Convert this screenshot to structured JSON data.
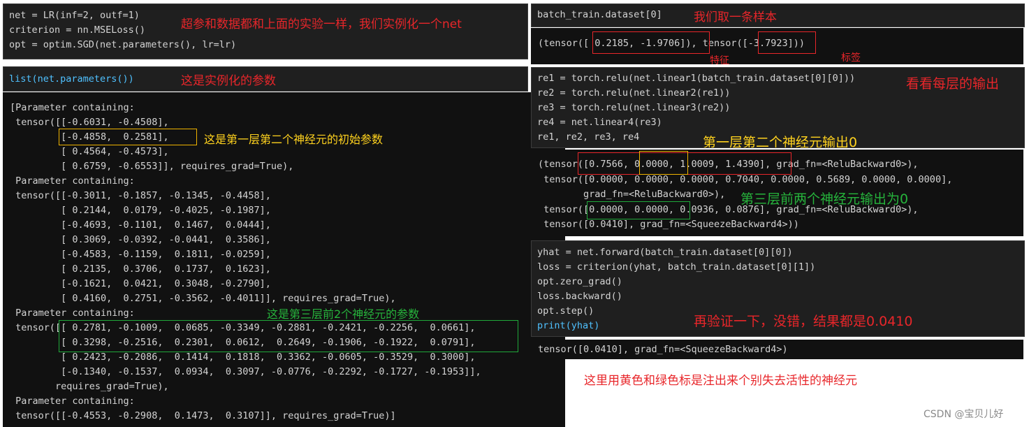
{
  "left": {
    "cell1": {
      "code": [
        "net = LR(inf=2, outf=1)",
        "criterion = nn.MSELoss()",
        "opt = optim.SGD(net.parameters(), lr=lr)"
      ],
      "note": "超参和数据都和上面的实验一样，我们实例化一个net"
    },
    "cell2": {
      "code": "list(net.parameters())",
      "note": "这是实例化的参数"
    },
    "output": {
      "lines": [
        "[Parameter containing:",
        " tensor([[-0.6031, -0.4508],",
        "         [-0.4858,  0.2581],",
        "         [ 0.4564, -0.4573],",
        "         [ 0.6759, -0.6553]], requires_grad=True),",
        " Parameter containing:",
        " tensor([[-0.3011, -0.1857, -0.1345, -0.4458],",
        "         [ 0.2144,  0.0179, -0.4025, -0.1987],",
        "         [-0.4693, -0.1101,  0.1467,  0.0444],",
        "         [ 0.3069, -0.0392, -0.0441,  0.3586],",
        "         [-0.4583, -0.1159,  0.1811, -0.0259],",
        "         [ 0.2135,  0.3706,  0.1737,  0.1623],",
        "         [-0.1621,  0.0421,  0.3048, -0.2790],",
        "         [ 0.4160,  0.2751, -0.3562, -0.4011]], requires_grad=True),",
        " Parameter containing:",
        " tensor([[ 0.2781, -0.1009,  0.0685, -0.3349, -0.2881, -0.2421, -0.2256,  0.0661],",
        "         [ 0.3298, -0.2516,  0.2301,  0.0612,  0.2649, -0.1906, -0.1922,  0.0791],",
        "         [ 0.2423, -0.2086,  0.1414,  0.1818,  0.3362, -0.0605, -0.3529,  0.3000],",
        "         [-0.1340, -0.1537,  0.0934,  0.3097, -0.0776, -0.2292, -0.1727, -0.1953]],",
        "        requires_grad=True),",
        " Parameter containing:",
        " tensor([[-0.4553, -0.2908,  0.1473,  0.3107]], requires_grad=True)]"
      ],
      "note_yellow": "这是第一层第二个神经元的初始参数",
      "note_green": "这是第三层前2个神经元的参数"
    }
  },
  "right": {
    "cell1": {
      "code": "batch_train.dataset[0]",
      "note": "我们取一条样本"
    },
    "out1": {
      "text": "(tensor([ 0.2185, -1.9706]), tensor([-3.7923]))",
      "label_feature": "特征",
      "label_target": "标签"
    },
    "cell2": {
      "code": [
        "re1 = torch.relu(net.linear1(batch_train.dataset[0][0]))",
        "re2 = torch.relu(net.linear2(re1))",
        "re3 = torch.relu(net.linear3(re2))",
        "re4 = net.linear4(re3)",
        "re1, re2, re3, re4"
      ],
      "note": "看看每层的输出",
      "note2": "第一层第二个神经元输出0"
    },
    "out2": {
      "lines": [
        "(tensor([0.7566, 0.0000, 1.0009, 1.4390], grad_fn=<ReluBackward0>),",
        " tensor([0.0000, 0.0000, 0.0000, 0.7040, 0.0000, 0.5689, 0.0000, 0.0000],",
        "        grad_fn=<ReluBackward0>),",
        " tensor([0.0000, 0.0000, 0.0936, 0.0876], grad_fn=<ReluBackward0>),",
        " tensor([0.0410], grad_fn=<SqueezeBackward4>))"
      ],
      "note": "第三层前两个神经元输出为0"
    },
    "cell3": {
      "code": [
        "yhat = net.forward(batch_train.dataset[0][0])",
        "loss = criterion(yhat, batch_train.dataset[0][1])",
        "opt.zero_grad()",
        "loss.backward()",
        "opt.step()",
        "print(yhat)"
      ],
      "note": "再验证一下，没错，结果都是0.0410"
    },
    "out3": {
      "text": "tensor([0.0410], grad_fn=<SqueezeBackward4>)"
    }
  },
  "footer": {
    "note": "这里用黄色和绿色标是注出来个别失去活性的神经元",
    "watermark": "CSDN @宝贝儿好"
  }
}
